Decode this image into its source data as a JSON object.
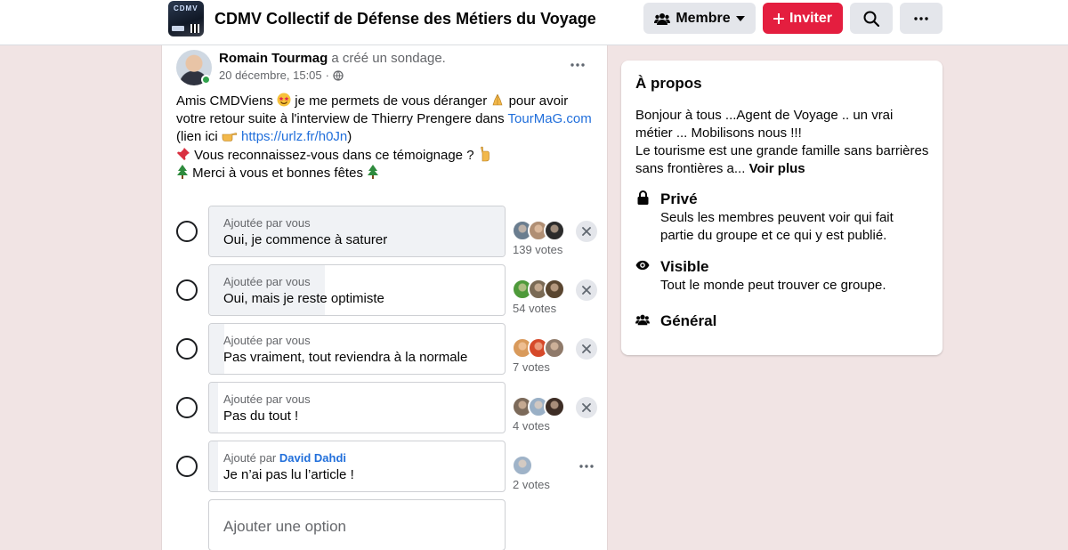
{
  "header": {
    "group_name": "CDMV Collectif de Défense des Métiers du Voyage",
    "thumb_text": "CDMV",
    "member_label": "Membre",
    "invite_label": "Inviter"
  },
  "post": {
    "author": "Romain Tourmag",
    "action": "a créé un sondage.",
    "date": "20 décembre, 15:05",
    "body": {
      "l1_a": "Amis CMDViens",
      "l1_b": "je me permets de vous déranger",
      "l1_c": "pour avoir",
      "l2_a": "votre retour suite à l'interview de Thierry Prengere dans",
      "l2_link": "TourMaG.com",
      "l3_a": "(lien ici",
      "l3_link": "https://urlz.fr/h0Jn",
      "l3_b": ")",
      "l4": "Vous reconnaissez-vous dans ce témoignage ?",
      "l5": "Merci à vous et bonnes fêtes"
    },
    "poll": {
      "options": [
        {
          "added_by": "Ajoutée par vous",
          "text": "Oui, je commence à saturer",
          "votes": "139 votes",
          "fill": 1.0
        },
        {
          "added_by": "Ajoutée par vous",
          "text": "Oui, mais je reste optimiste",
          "votes": "54 votes",
          "fill": 0.39
        },
        {
          "added_by": "Ajoutée par vous",
          "text": "Pas vraiment, tout reviendra à la normale",
          "votes": "7 votes",
          "fill": 0.05
        },
        {
          "added_by": "Ajoutée par vous",
          "text": "Pas du tout !",
          "votes": "4 votes",
          "fill": 0.03
        },
        {
          "added_by": "Ajouté par",
          "added_by_name": "David Dahdi",
          "text": "Je n’ai pas lu l’article !",
          "votes": "2 votes",
          "fill": 0.01
        }
      ],
      "add_option_placeholder": "Ajouter une option"
    }
  },
  "about": {
    "title": "À propos",
    "desc_l1": "Bonjour à tous ...Agent de Voyage .. un vrai",
    "desc_l2": "métier ... Mobilisons nous !!!",
    "desc_l3": "Le tourisme est une grande famille sans barrières",
    "desc_l4": "sans frontières a...",
    "see_more": "Voir plus",
    "private_title": "Privé",
    "private_l1": "Seuls les membres peuvent voir qui fait",
    "private_l2": "partie du groupe et ce qui y est publié.",
    "visible_title": "Visible",
    "visible_desc": "Tout le monde peut trouver ce groupe.",
    "general_title": "Général"
  },
  "colors": {
    "accent_red": "#e41e3f",
    "link_blue": "#216fdb",
    "page_bg": "#f1e4e4",
    "online_green": "#31a24c"
  }
}
